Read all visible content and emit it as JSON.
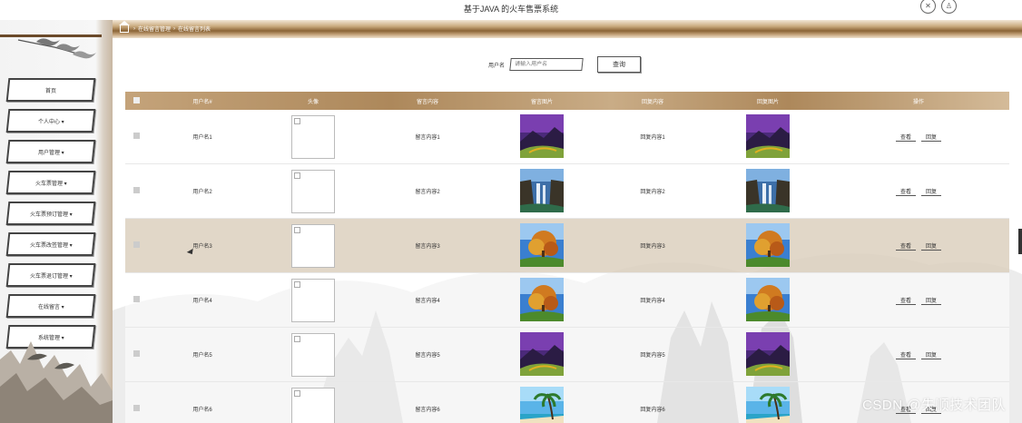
{
  "app": {
    "title": "基于JAVA 的火车售票系统"
  },
  "breadcrumb": {
    "item1": "在线留言管理",
    "item2": "在线留言列表",
    "sep": "›"
  },
  "sidebar": {
    "items": [
      {
        "label": "首页"
      },
      {
        "label": "个人中心 ▾"
      },
      {
        "label": "用户管理 ▾"
      },
      {
        "label": "火车票管理 ▾"
      },
      {
        "label": "火车票预订管理 ▾"
      },
      {
        "label": "火车票改签管理 ▾"
      },
      {
        "label": "火车票退订管理 ▾"
      },
      {
        "label": "在线留言 ▾"
      },
      {
        "label": "系统管理 ▾"
      }
    ]
  },
  "search": {
    "label": "用户名",
    "placeholder": "请输入用户名",
    "button": "查询"
  },
  "table": {
    "headers": [
      "",
      "用户名#",
      "头像",
      "留言内容",
      "留言图片",
      "回复内容",
      "回复图片",
      "操作"
    ],
    "rows": [
      {
        "username": "用户名1",
        "content": "留言内容1",
        "reply": "回复内容1",
        "img": "mountain-purple"
      },
      {
        "username": "用户名2",
        "content": "留言内容2",
        "reply": "回复内容2",
        "img": "waterfall"
      },
      {
        "username": "用户名3",
        "content": "留言内容3",
        "reply": "回复内容3",
        "img": "autumn-tree"
      },
      {
        "username": "用户名4",
        "content": "留言内容4",
        "reply": "回复内容4",
        "img": "autumn-tree"
      },
      {
        "username": "用户名5",
        "content": "留言内容5",
        "reply": "回复内容5",
        "img": "mountain-purple"
      },
      {
        "username": "用户名6",
        "content": "留言内容6",
        "reply": "回复内容6",
        "img": "beach"
      }
    ],
    "actions": {
      "view": "查看",
      "reply": "回复"
    }
  },
  "watermark": "CSDN @失顺技术团队",
  "colors": {
    "accent": "#ad885b",
    "highlight_row": "#dcd0be"
  }
}
